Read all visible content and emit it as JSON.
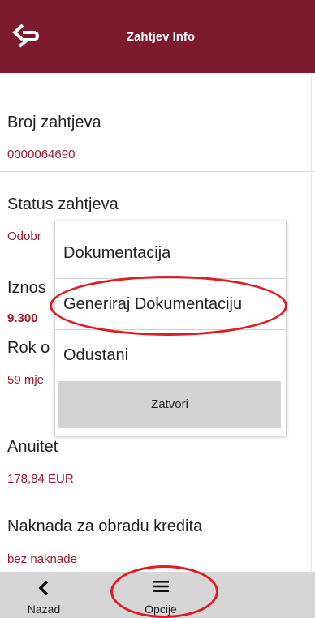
{
  "header": {
    "title": "Zahtjev Info",
    "logo_icon": "bank-logo-icon",
    "color": "#7d1a2e"
  },
  "fields": [
    {
      "label": "Broj zahtjeva",
      "value": "0000064690"
    },
    {
      "label": "Status zahtjeva",
      "value": "Odobr"
    },
    {
      "label": "Iznos",
      "value": "9.300"
    },
    {
      "label": "Rok o",
      "value": "59 mje"
    },
    {
      "label": "Anuitet",
      "value": "178,84 EUR"
    },
    {
      "label": "Naknada za obradu kredita",
      "value": "bez naknade"
    }
  ],
  "popup": {
    "items": [
      "Dokumentacija",
      "Generiraj Dokumentaciju",
      "Odustani"
    ],
    "close_label": "Zatvori"
  },
  "bottom_bar": {
    "back": {
      "label": "Nazad",
      "icon": "chevron-left-icon"
    },
    "options": {
      "label": "Opcije",
      "icon": "menu-icon"
    }
  },
  "accent_color": "#9b1b2c",
  "annotation_color": "#e21b23"
}
